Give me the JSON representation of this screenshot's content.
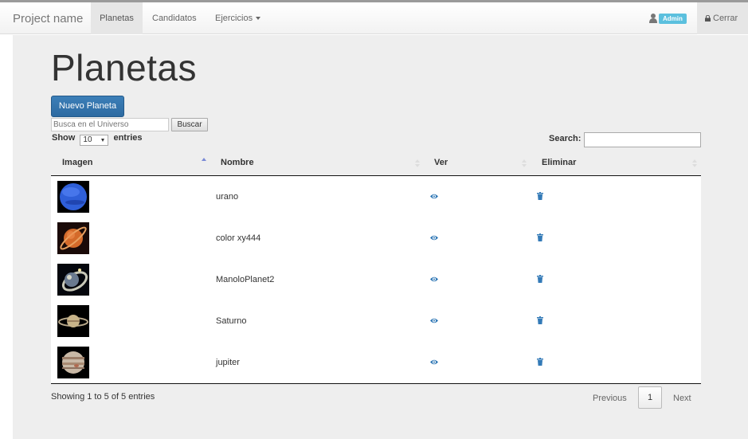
{
  "navbar": {
    "brand": "Project name",
    "items": [
      {
        "label": "Planetas",
        "active": true
      },
      {
        "label": "Candidatos",
        "active": false
      },
      {
        "label": "Ejercicios",
        "active": false
      }
    ],
    "user_icon": "user-icon",
    "user_badge": "Admin",
    "logout_icon": "lock-icon",
    "logout_label": "Cerrar"
  },
  "page": {
    "title": "Planetas",
    "new_button": "Nuevo Planeta",
    "search_placeholder": "Busca en el Universo",
    "search_button": "Buscar"
  },
  "table": {
    "length_prefix": "Show",
    "length_value": "10",
    "length_suffix": "entries",
    "search_label": "Search:",
    "columns": [
      "Imagen",
      "Nombre",
      "Ver",
      "Eliminar"
    ],
    "sorted_column": "Imagen",
    "rows": [
      {
        "image": "neptune-like blue planet",
        "name": "urano"
      },
      {
        "image": "ringed orange planet",
        "name": "color xy444"
      },
      {
        "image": "galaxy planet",
        "name": "ManoloPlanet2"
      },
      {
        "image": "saturn",
        "name": "Saturno"
      },
      {
        "image": "jupiter",
        "name": "jupiter"
      }
    ],
    "view_icon": "eye-icon",
    "delete_icon": "trash-icon",
    "info": "Showing 1 to 5 of 5 entries",
    "pagination": {
      "previous": "Previous",
      "current": "1",
      "next": "Next"
    }
  },
  "colors": {
    "primary_button": "#2d6aa1",
    "badge": "#5bc0de",
    "icon_blue": "#337ab7",
    "panel_bg": "#eeeeee"
  }
}
